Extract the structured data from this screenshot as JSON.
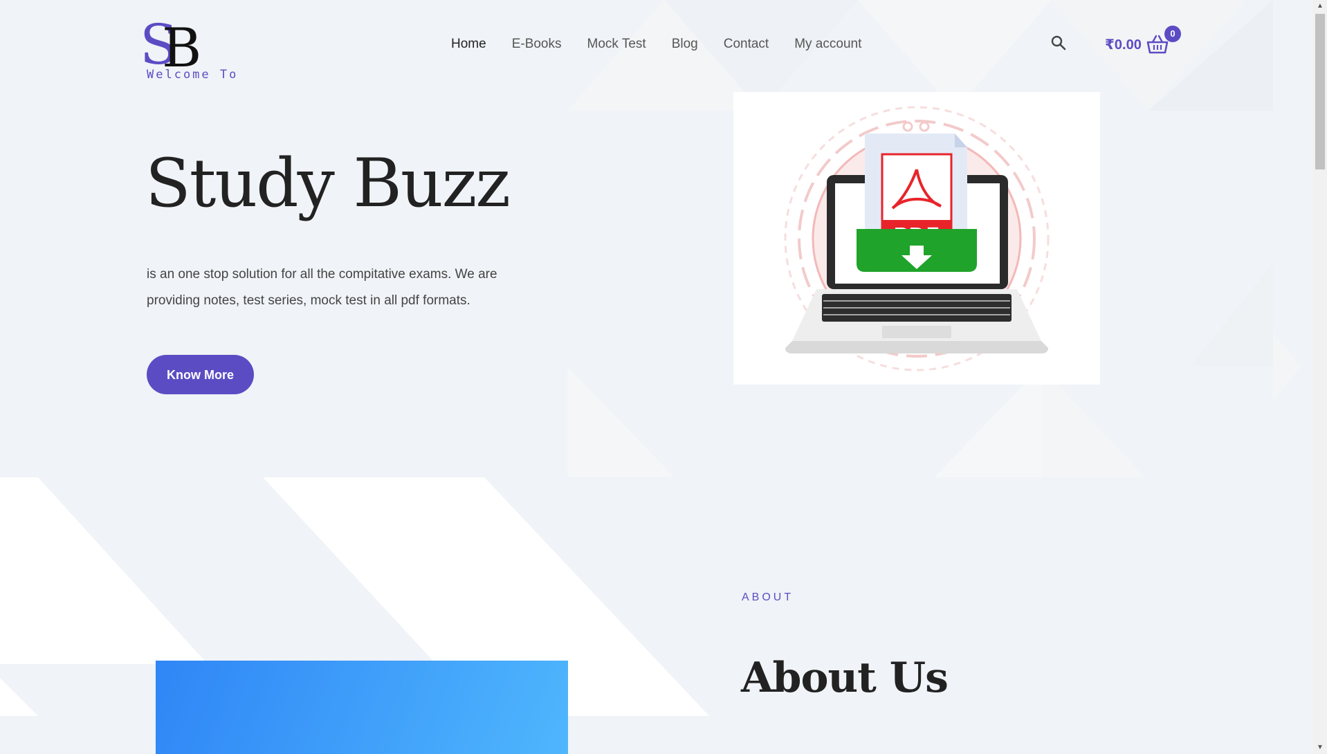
{
  "header": {
    "logo_text": "SB",
    "logo_caption": "Welcome To",
    "nav": [
      {
        "label": "Home",
        "active": true
      },
      {
        "label": "E-Books",
        "active": false
      },
      {
        "label": "Mock Test",
        "active": false
      },
      {
        "label": "Blog",
        "active": false
      },
      {
        "label": "Contact",
        "active": false
      },
      {
        "label": "My account",
        "active": false
      }
    ],
    "search_icon": "search-icon",
    "cart": {
      "total": "₹0.00",
      "count": "0",
      "icon": "shopping-basket-icon"
    }
  },
  "hero": {
    "title": "Study Buzz",
    "description": "is an one stop solution for all the compitative exams. We are providing notes, test series, mock test in all pdf formats.",
    "cta_label": "Know More",
    "image": {
      "label": "PDF",
      "icon": "laptop-pdf-download-illustration"
    }
  },
  "about": {
    "eyebrow": "ABOUT",
    "title": "About Us"
  },
  "colors": {
    "accent": "#5b4cc4",
    "background": "#f0f3f7",
    "pdf_red": "#e8242a",
    "download_green": "#1fa32a",
    "about_gradient_start": "#2f86f6",
    "about_gradient_end": "#4fb6fd"
  }
}
